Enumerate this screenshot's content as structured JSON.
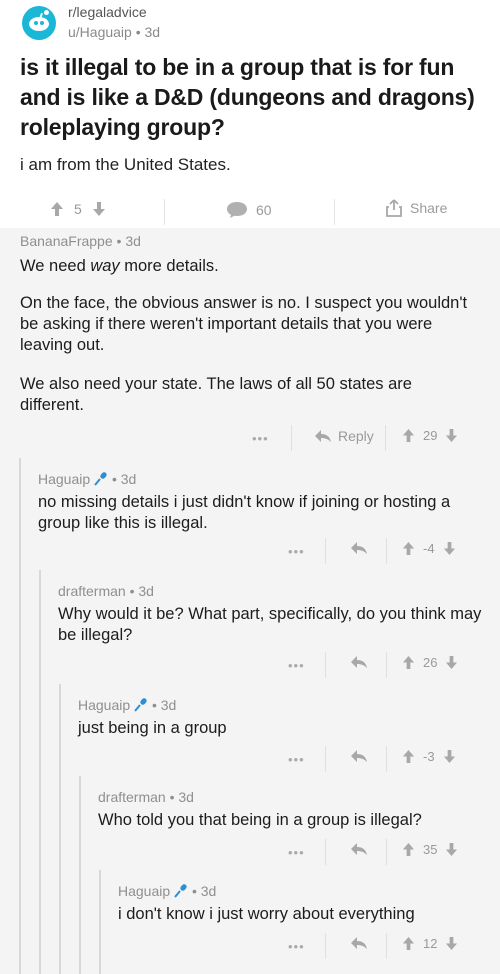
{
  "post": {
    "subreddit": "r/legaladvice",
    "author_meta": "u/Haguaip • 3d",
    "title": "is it illegal to be in a group that is for fun and is like a D&D (dungeons and dragons) roleplaying group?",
    "body": "i am from the United States.",
    "score": "5",
    "comments": "60",
    "share_label": "Share"
  },
  "comments": [
    {
      "author": "BananaFrappe",
      "age": "3d",
      "body_lines": [
        "We need ",
        "way",
        " more details."
      ],
      "body2": "On the face, the obvious answer is no. I suspect you wouldn't be asking if there weren't important details that you were leaving out.",
      "body3": "We also need your state. The laws of all 50 states are different.",
      "reply_label": "Reply",
      "score": "29"
    },
    {
      "author": "Haguaip",
      "age": "3d",
      "body": "no missing details i just didn't know if joining or hosting a group like this is illegal.",
      "score": "-4"
    },
    {
      "author": "drafterman",
      "age": "3d",
      "body": "Why would it be? What part, specifically, do you think may be illegal?",
      "score": "26"
    },
    {
      "author": "Haguaip",
      "age": "3d",
      "body": "just being in a group",
      "score": "-3"
    },
    {
      "author": "drafterman",
      "age": "3d",
      "body": "Who told you that being in a group is illegal?",
      "score": "35"
    },
    {
      "author": "Haguaip",
      "age": "3d",
      "body": "i don't know i just worry about everything",
      "score": "12"
    }
  ],
  "ui": {
    "dots": "•••",
    "meta_sep": "•",
    "accent": "#1ab7d6",
    "mic_color": "#2a8fd6"
  }
}
